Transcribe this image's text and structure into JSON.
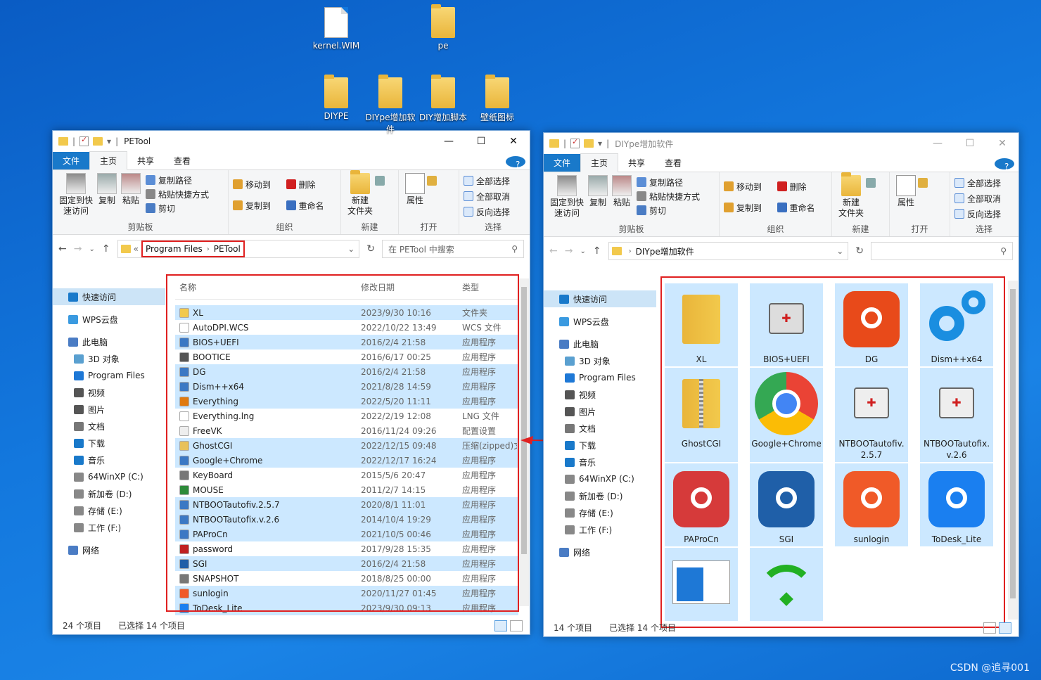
{
  "desktop": {
    "icons": [
      {
        "label": "kernel.WIM",
        "kind": "file"
      },
      {
        "label": "pe",
        "kind": "folder"
      },
      {
        "label": "DIYPE",
        "kind": "folder"
      },
      {
        "label": "DIYpe增加软件",
        "kind": "folder"
      },
      {
        "label": "DIY增加脚本",
        "kind": "folder"
      },
      {
        "label": "壁纸图标",
        "kind": "folder"
      }
    ]
  },
  "ribbon": {
    "tabs": [
      "文件",
      "主页",
      "共享",
      "查看"
    ],
    "pin": "固定到快\n速访问",
    "copy": "复制",
    "paste": "粘贴",
    "copy_path": "复制路径",
    "paste_shortcut": "粘贴快捷方式",
    "cut": "剪切",
    "move_to": "移动到",
    "copy_to": "复制到",
    "delete": "删除",
    "rename": "重命名",
    "new_folder": "新建\n文件夹",
    "properties": "属性",
    "select_all": "全部选择",
    "select_none": "全部取消",
    "invert": "反向选择",
    "groups": [
      "剪贴板",
      "组织",
      "新建",
      "打开",
      "选择"
    ]
  },
  "nav": [
    "快速访问",
    "WPS云盘",
    "此电脑",
    "3D 对象",
    "Program Files",
    "视频",
    "图片",
    "文档",
    "下载",
    "音乐",
    "64WinXP  (C:)",
    "新加卷 (D:)",
    "存储 (E:)",
    "工作 (F:)",
    "网络"
  ],
  "left": {
    "title": "PETool",
    "address": {
      "prefix": "«",
      "crumbs": [
        "Program Files",
        "PETool"
      ]
    },
    "search_placeholder": "在 PETool 中搜索",
    "columns": [
      "名称",
      "修改日期",
      "类型"
    ],
    "rows": [
      {
        "name": "XL",
        "date": "2023/9/30 10:16",
        "type": "文件夹",
        "sel": true,
        "icon": "folder-icon",
        "color": "#f2c94c"
      },
      {
        "name": "AutoDPI.WCS",
        "date": "2022/10/22 13:49",
        "type": "WCS 文件",
        "sel": false,
        "icon": "file-icon",
        "color": "#ffffff"
      },
      {
        "name": "BIOS+UEFI",
        "date": "2016/2/4 21:58",
        "type": "应用程序",
        "sel": true,
        "icon": "app-icon",
        "color": "#3b78c4"
      },
      {
        "name": "BOOTICE",
        "date": "2016/6/17 00:25",
        "type": "应用程序",
        "sel": false,
        "icon": "app-icon",
        "color": "#555555"
      },
      {
        "name": "DG",
        "date": "2016/2/4 21:58",
        "type": "应用程序",
        "sel": true,
        "icon": "app-icon",
        "color": "#3b78c4"
      },
      {
        "name": "Dism++x64",
        "date": "2021/8/28 14:59",
        "type": "应用程序",
        "sel": true,
        "icon": "app-icon",
        "color": "#3b78c4"
      },
      {
        "name": "Everything",
        "date": "2022/5/20 11:11",
        "type": "应用程序",
        "sel": true,
        "icon": "search-icon",
        "color": "#e07a10"
      },
      {
        "name": "Everything.lng",
        "date": "2022/2/19 12:08",
        "type": "LNG 文件",
        "sel": false,
        "icon": "file-icon",
        "color": "#ffffff"
      },
      {
        "name": "FreeVK",
        "date": "2016/11/24 09:26",
        "type": "配置设置",
        "sel": false,
        "icon": "file-icon",
        "color": "#eeeeee"
      },
      {
        "name": "GhostCGI",
        "date": "2022/12/15 09:48",
        "type": "压缩(zipped)文",
        "sel": true,
        "icon": "zip-icon",
        "color": "#e8c15a"
      },
      {
        "name": "Google+Chrome",
        "date": "2022/12/17 16:24",
        "type": "应用程序",
        "sel": true,
        "icon": "app-icon",
        "color": "#3b78c4"
      },
      {
        "name": "KeyBoard",
        "date": "2015/5/6 20:47",
        "type": "应用程序",
        "sel": false,
        "icon": "app-icon",
        "color": "#777777"
      },
      {
        "name": "MOUSE",
        "date": "2011/2/7 14:15",
        "type": "应用程序",
        "sel": false,
        "icon": "app-icon",
        "color": "#2e8b3a"
      },
      {
        "name": "NTBOOTautofiv.2.5.7",
        "date": "2020/8/1 11:01",
        "type": "应用程序",
        "sel": true,
        "icon": "app-icon",
        "color": "#3b78c4"
      },
      {
        "name": "NTBOOTautofix.v.2.6",
        "date": "2014/10/4 19:29",
        "type": "应用程序",
        "sel": true,
        "icon": "app-icon",
        "color": "#3b78c4"
      },
      {
        "name": "PAProCn",
        "date": "2021/10/5 00:46",
        "type": "应用程序",
        "sel": true,
        "icon": "app-icon",
        "color": "#3b78c4"
      },
      {
        "name": "password",
        "date": "2017/9/28 15:35",
        "type": "应用程序",
        "sel": false,
        "icon": "app-icon",
        "color": "#c02020"
      },
      {
        "name": "SGI",
        "date": "2016/2/4 21:58",
        "type": "应用程序",
        "sel": true,
        "icon": "app-icon",
        "color": "#1f5fa8"
      },
      {
        "name": "SNAPSHOT",
        "date": "2018/8/25 00:00",
        "type": "应用程序",
        "sel": false,
        "icon": "app-icon",
        "color": "#777777"
      },
      {
        "name": "sunlogin",
        "date": "2020/11/27 01:45",
        "type": "应用程序",
        "sel": true,
        "icon": "app-icon",
        "color": "#f05a28"
      },
      {
        "name": "ToDesk_Lite",
        "date": "2023/9/30 09:13",
        "type": "应用程序",
        "sel": true,
        "icon": "app-icon",
        "color": "#1a7ff0"
      }
    ],
    "status": {
      "count": "24 个项目",
      "selected": "已选择 14 个项目"
    }
  },
  "right": {
    "title": "DIYpe增加软件",
    "address": {
      "prefix": "",
      "crumbs": [
        "DIYpe增加软件"
      ]
    },
    "tiles": [
      {
        "label": "XL",
        "icon": "folder-icon",
        "color": "#f2c94c"
      },
      {
        "label": "BIOS+UEFI",
        "icon": "bios-icon",
        "color": "#dddddd"
      },
      {
        "label": "DG",
        "icon": "diskgenius-icon",
        "color": "#e84a1a"
      },
      {
        "label": "Dism++x64",
        "icon": "gear-icon",
        "color": "#1a8ee0"
      },
      {
        "label": "GhostCGI",
        "icon": "zip-folder-icon",
        "color": "#f2c94c"
      },
      {
        "label": "Google+Chrome",
        "icon": "chrome-icon",
        "color": "#34a853"
      },
      {
        "label": "NTBOOTautofiv.2.5.7",
        "icon": "toolbox-icon",
        "color": "#eeeeee"
      },
      {
        "label": "NTBOOTautofix.v.2.6",
        "icon": "toolbox-icon",
        "color": "#eeeeee"
      },
      {
        "label": "PAProCn",
        "icon": "partition-icon",
        "color": "#d63a3a"
      },
      {
        "label": "SGI",
        "icon": "sgi-icon",
        "color": "#1f5fa8"
      },
      {
        "label": "sunlogin",
        "icon": "sunlogin-icon",
        "color": "#f05a28"
      },
      {
        "label": "ToDesk_Lite",
        "icon": "todesk-icon",
        "color": "#1a7ff0"
      },
      {
        "label": "",
        "icon": "window-icon",
        "color": "#1e78d6"
      },
      {
        "label": "",
        "icon": "wifi-icon",
        "color": "#22b022"
      }
    ],
    "status": {
      "count": "14 个项目",
      "selected": "已选择 14 个项目"
    }
  },
  "watermark": "CSDN @追寻001"
}
